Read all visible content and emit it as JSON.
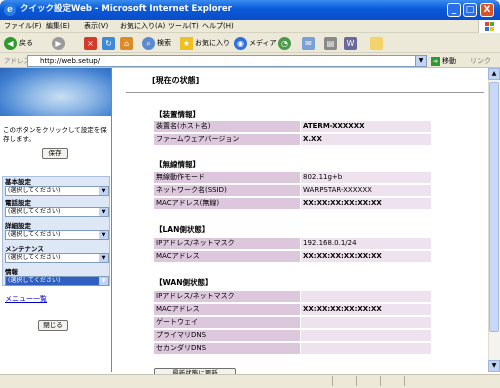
{
  "window": {
    "title": "クイック設定Web - Microsoft Internet Explorer",
    "minimize": "_",
    "maximize": "□",
    "close": "X"
  },
  "menu": {
    "items": [
      "ファイル(F)",
      "編集(E)",
      "表示(V)",
      "お気に入り(A)",
      "ツール(T)",
      "ヘルプ(H)"
    ]
  },
  "toolbar": {
    "back": "戻る",
    "search": "検索",
    "favorites": "お気に入り",
    "media": "メディア"
  },
  "address": {
    "label": "アドレス(D)",
    "url": "http://web.setup/",
    "go": "移動",
    "links": "リンク"
  },
  "sidebar": {
    "note": "このボタンをクリックして設定を保存します。",
    "save_button": "保存",
    "sections": [
      {
        "title": "基本設定",
        "select": "(選択してください)"
      },
      {
        "title": "電話設定",
        "select": "(選択してください)"
      },
      {
        "title": "詳細設定",
        "select": "(選択してください)"
      },
      {
        "title": "メンテナンス",
        "select": "(選択してください)"
      },
      {
        "title": "情報",
        "select": "(選択してください)"
      }
    ],
    "menu_link": "メニュー一覧",
    "close_button": "閉じる"
  },
  "main": {
    "heading": "[現在の状態]",
    "device_info": {
      "title": "【装置情報】",
      "rows": [
        {
          "label": "装置名(ホスト名)",
          "value": "ATERM-XXXXXX"
        },
        {
          "label": "ファームウェアバージョン",
          "value": "X.XX"
        }
      ]
    },
    "wireless_info": {
      "title": "【無線情報】",
      "rows": [
        {
          "label": "無線動作モード",
          "value": "802.11g+b"
        },
        {
          "label": "ネットワーク名(SSID)",
          "value": "WARPSTAR-XXXXXX"
        },
        {
          "label": "MACアドレス(無線)",
          "value": "XX:XX:XX:XX:XX:XX"
        }
      ]
    },
    "lan_status": {
      "title": "【LAN側状態】",
      "rows": [
        {
          "label": "IPアドレス/ネットマスク",
          "value": "192.168.0.1/24"
        },
        {
          "label": "MACアドレス",
          "value": "XX:XX:XX:XX:XX:XX"
        }
      ]
    },
    "wan_status": {
      "title": "【WAN側状態】",
      "rows": [
        {
          "label": "IPアドレス/ネットマスク",
          "value": ""
        },
        {
          "label": "MACアドレス",
          "value": "XX:XX:XX:XX:XX:XX"
        },
        {
          "label": "ゲートウェイ",
          "value": ""
        },
        {
          "label": "プライマリDNS",
          "value": ""
        },
        {
          "label": "セカンダリDNS",
          "value": ""
        }
      ]
    },
    "refresh_button": "最新状態に更新"
  }
}
